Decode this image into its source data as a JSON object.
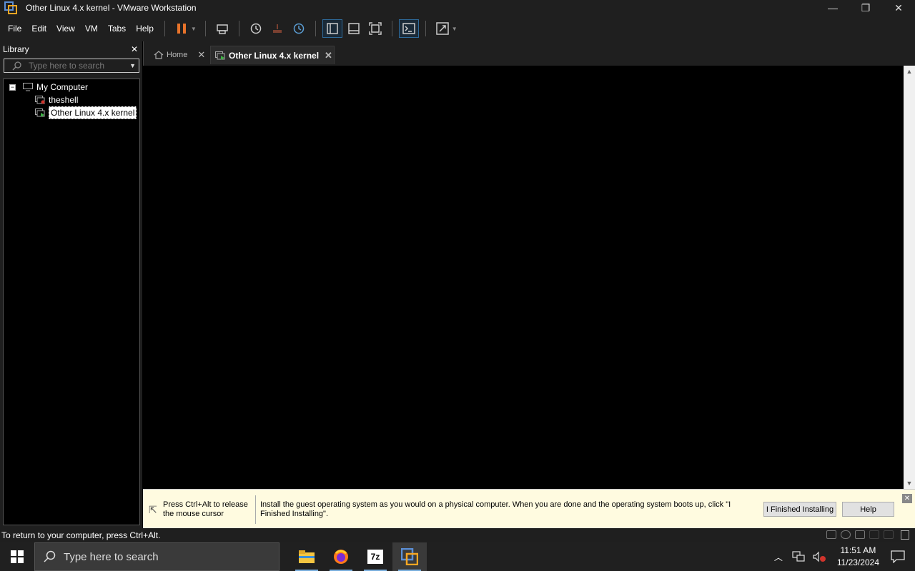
{
  "window": {
    "title": "Other Linux 4.x kernel - VMware Workstation",
    "minimize": "—",
    "maximize": "❐",
    "close": "✕"
  },
  "menu": [
    "File",
    "Edit",
    "View",
    "VM",
    "Tabs",
    "Help"
  ],
  "library": {
    "title": "Library",
    "close": "✕",
    "search_placeholder": "Type here to search",
    "tree": {
      "root": "My Computer",
      "items": [
        "theshell",
        "Other Linux 4.x kernel"
      ],
      "selected": "Other Linux 4.x kernel"
    }
  },
  "tabs": [
    {
      "label": "Home",
      "active": false
    },
    {
      "label": "Other Linux 4.x kernel",
      "active": true
    }
  ],
  "infobar": {
    "press_text": "Press Ctrl+Alt to release the mouse cursor",
    "install_text": "Install the guest operating system as you would on a physical computer. When you are done and the operating system boots up, click \"I Finished Installing\".",
    "finished_button": "I Finished Installing",
    "help_button": "Help"
  },
  "statusbar": {
    "text": "To return to your computer, press Ctrl+Alt."
  },
  "taskbar": {
    "search_placeholder": "Type here to search",
    "apps": [
      "file-explorer",
      "firefox",
      "7zip",
      "vmware-workstation"
    ],
    "sevenzip_label": "7z",
    "time": "11:51 AM",
    "date": "11/23/2024"
  },
  "colors": {
    "accent": "#e8732a",
    "selection_border": "#2e6a9a",
    "infobar_bg": "#fffbe0"
  }
}
